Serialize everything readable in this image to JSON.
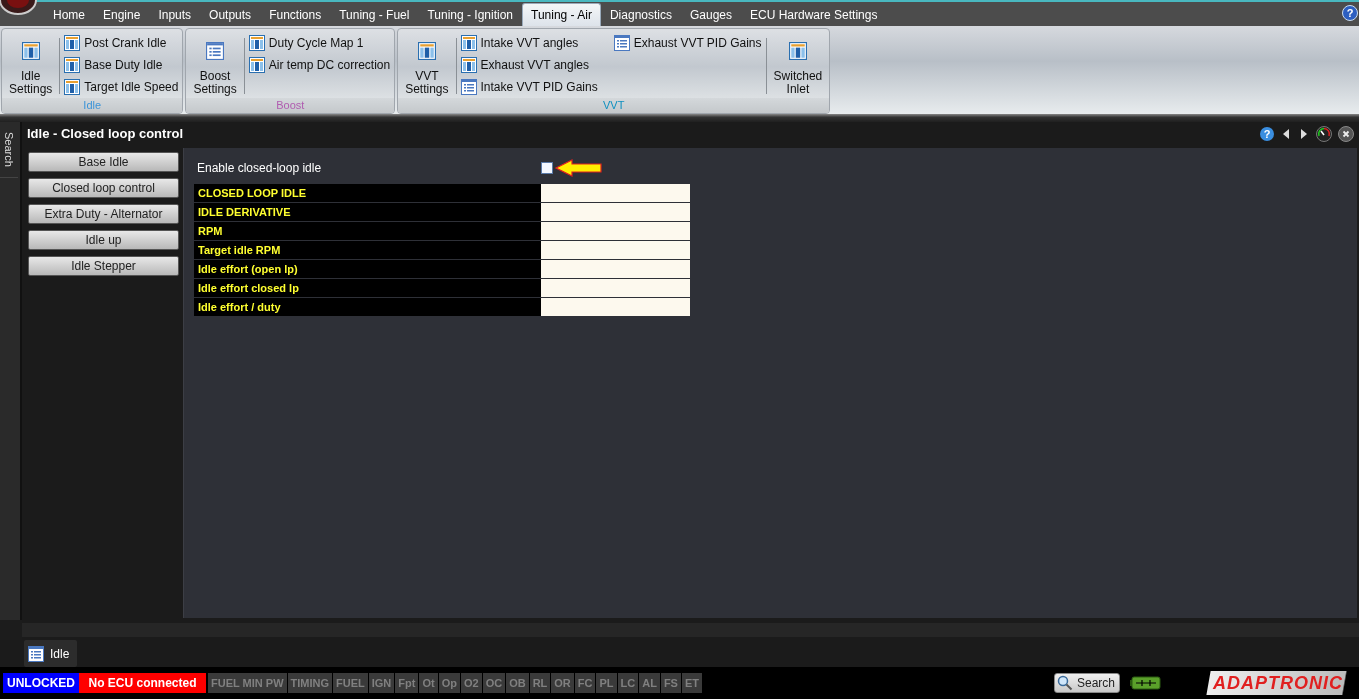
{
  "menu_tabs": [
    {
      "label": "Home",
      "selected": false
    },
    {
      "label": "Engine",
      "selected": false
    },
    {
      "label": "Inputs",
      "selected": false
    },
    {
      "label": "Outputs",
      "selected": false
    },
    {
      "label": "Functions",
      "selected": false
    },
    {
      "label": "Tuning - Fuel",
      "selected": false
    },
    {
      "label": "Tuning - Ignition",
      "selected": false
    },
    {
      "label": "Tuning - Air",
      "selected": true
    },
    {
      "label": "Diagnostics",
      "selected": false
    },
    {
      "label": "Gauges",
      "selected": false
    },
    {
      "label": "ECU Hardware Settings",
      "selected": false
    }
  ],
  "menu_help": "?",
  "ribbon_groups": [
    {
      "label": "Idle",
      "color": "#3c94d8",
      "sections": [
        {
          "kind": "large_map",
          "label": "Idle Settings"
        },
        {
          "kind": "items",
          "items": [
            {
              "label": "Post Crank Idle",
              "kind": "map"
            },
            {
              "label": "Base Duty Idle",
              "kind": "map"
            },
            {
              "label": "Target Idle Speed",
              "kind": "map"
            }
          ]
        }
      ]
    },
    {
      "label": "Boost",
      "color": "#b05cb0",
      "sections": [
        {
          "kind": "large_list",
          "label": "Boost Settings"
        },
        {
          "kind": "items",
          "items": [
            {
              "label": "Duty Cycle Map 1",
              "kind": "map"
            },
            {
              "label": "Air temp DC correction",
              "kind": "map"
            }
          ]
        }
      ]
    },
    {
      "label": "VVT",
      "color": "#1090c0",
      "sections": [
        {
          "kind": "large_map",
          "label": "VVT Settings"
        },
        {
          "kind": "items",
          "items": [
            {
              "label": "Intake VVT angles",
              "kind": "map"
            },
            {
              "label": "Exhaust VVT angles",
              "kind": "map"
            },
            {
              "label": "Intake VVT PID Gains",
              "kind": "list"
            },
            {
              "label": "Exhaust VVT PID Gains",
              "kind": "list"
            }
          ]
        },
        {
          "kind": "large_map",
          "label": "Switched Inlet"
        }
      ]
    }
  ],
  "side_tab": "Search",
  "panel": {
    "title": "Idle - Closed loop control",
    "help": "?",
    "nav_buttons": [
      "Base Idle",
      "Closed loop control",
      "Extra Duty - Alternator",
      "Idle up",
      "Idle Stepper"
    ],
    "enable": {
      "label": "Enable closed-loop idle",
      "checked": false
    },
    "rows": [
      "CLOSED LOOP IDLE",
      "IDLE DERIVATIVE",
      "RPM",
      "Target idle RPM",
      "Idle effort (open lp)",
      "Idle effort closed lp",
      "Idle effort / duty"
    ]
  },
  "doc_tabs": [
    {
      "label": "Idle"
    }
  ],
  "status_bar": {
    "lock": "UNLOCKED",
    "connection": "No ECU connected",
    "indicators": [
      "FUEL MIN PW",
      "TIMING",
      "FUEL",
      "IGN",
      "Fpt",
      "Ot",
      "Op",
      "O2",
      "OC",
      "OB",
      "RL",
      "OR",
      "FC",
      "PL",
      "LC",
      "AL",
      "FS",
      "ET"
    ],
    "search": "Search",
    "logo": "ADAPTRONIC"
  }
}
